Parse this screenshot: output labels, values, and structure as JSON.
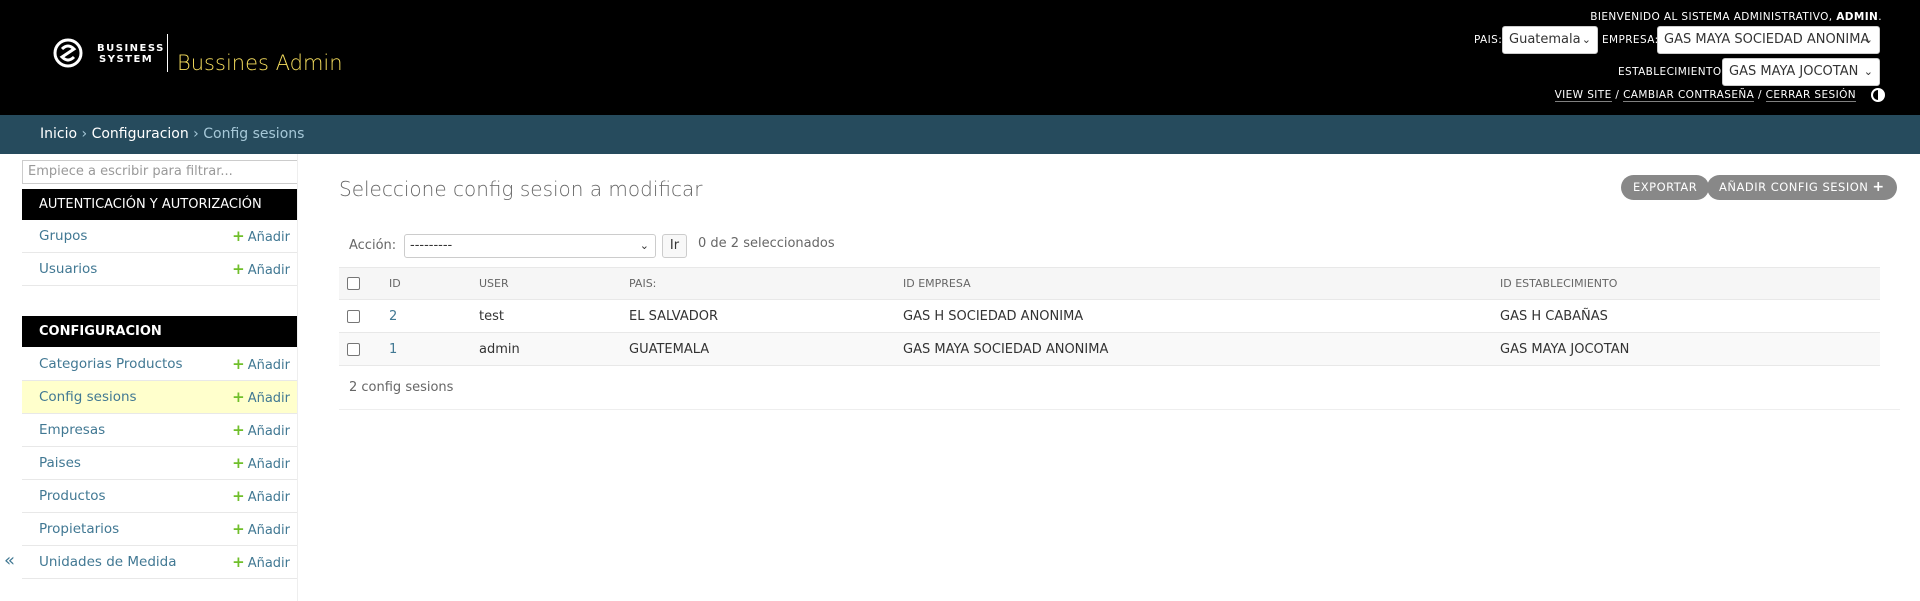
{
  "header": {
    "logo_text_line1": "BUSINESS",
    "logo_text_line2": "SYSTEM",
    "site_name": "Bussines Admin",
    "welcome_prefix": "Bienvenido al sistema administrativo,",
    "welcome_user": "admin",
    "pais_label": "Pais:",
    "pais_value": "Guatemala",
    "empresa_label": "Empresa:",
    "empresa_value": "GAS MAYA SOCIEDAD ANONIMA",
    "establecimiento_label": "Establecimiento:",
    "establecimiento_value": "GAS MAYA JOCOTAN",
    "view_site": "View site",
    "change_password": "Cambiar contraseña",
    "logout": "Cerrar sesión",
    "separator": "/"
  },
  "breadcrumbs": {
    "home": "Inicio",
    "app": "Configuracion",
    "current": "Config sesions",
    "sep": "›"
  },
  "sidebar": {
    "filter_placeholder": "Empiece a escribir para filtrar...",
    "add_label": "Añadir",
    "groups": [
      {
        "caption": "Autenticación y autorización",
        "items": [
          {
            "label": "Grupos"
          },
          {
            "label": "Usuarios"
          }
        ]
      },
      {
        "caption": "Configuracion",
        "items": [
          {
            "label": "Categorias Productos"
          },
          {
            "label": "Config sesions"
          },
          {
            "label": "Empresas"
          },
          {
            "label": "Paises"
          },
          {
            "label": "Productos"
          },
          {
            "label": "Propietarios"
          },
          {
            "label": "Unidades de Medida"
          }
        ]
      }
    ],
    "collapse": "«"
  },
  "content": {
    "title": "Seleccione config sesion a modificar",
    "export_button": "Exportar",
    "add_button": "Añadir config sesion",
    "action_label": "Acción:",
    "action_value": "---------",
    "go_button": "Ir",
    "counter": "0 de 2 seleccionados",
    "columns": [
      "ID",
      "User",
      "Pais:",
      "Id Empresa",
      "Id Establecimiento"
    ],
    "rows": [
      {
        "id": "2",
        "user": "test",
        "pais": "EL SALVADOR",
        "empresa": "GAS H SOCIEDAD ANONIMA",
        "establecimiento": "GAS H CABAÑAS"
      },
      {
        "id": "1",
        "user": "admin",
        "pais": "GUATEMALA",
        "empresa": "GAS MAYA SOCIEDAD ANONIMA",
        "establecimiento": "GAS MAYA JOCOTAN"
      }
    ],
    "paginator": "2 config sesions"
  },
  "colors": {
    "header_bg": "#000000",
    "site_name": "#f5dd5d",
    "breadcrumbs_bg": "#264b5d",
    "link": "#417893",
    "add_plus": "#70bf2b",
    "current_row": "#ffffcc",
    "button_bg": "#888888"
  }
}
